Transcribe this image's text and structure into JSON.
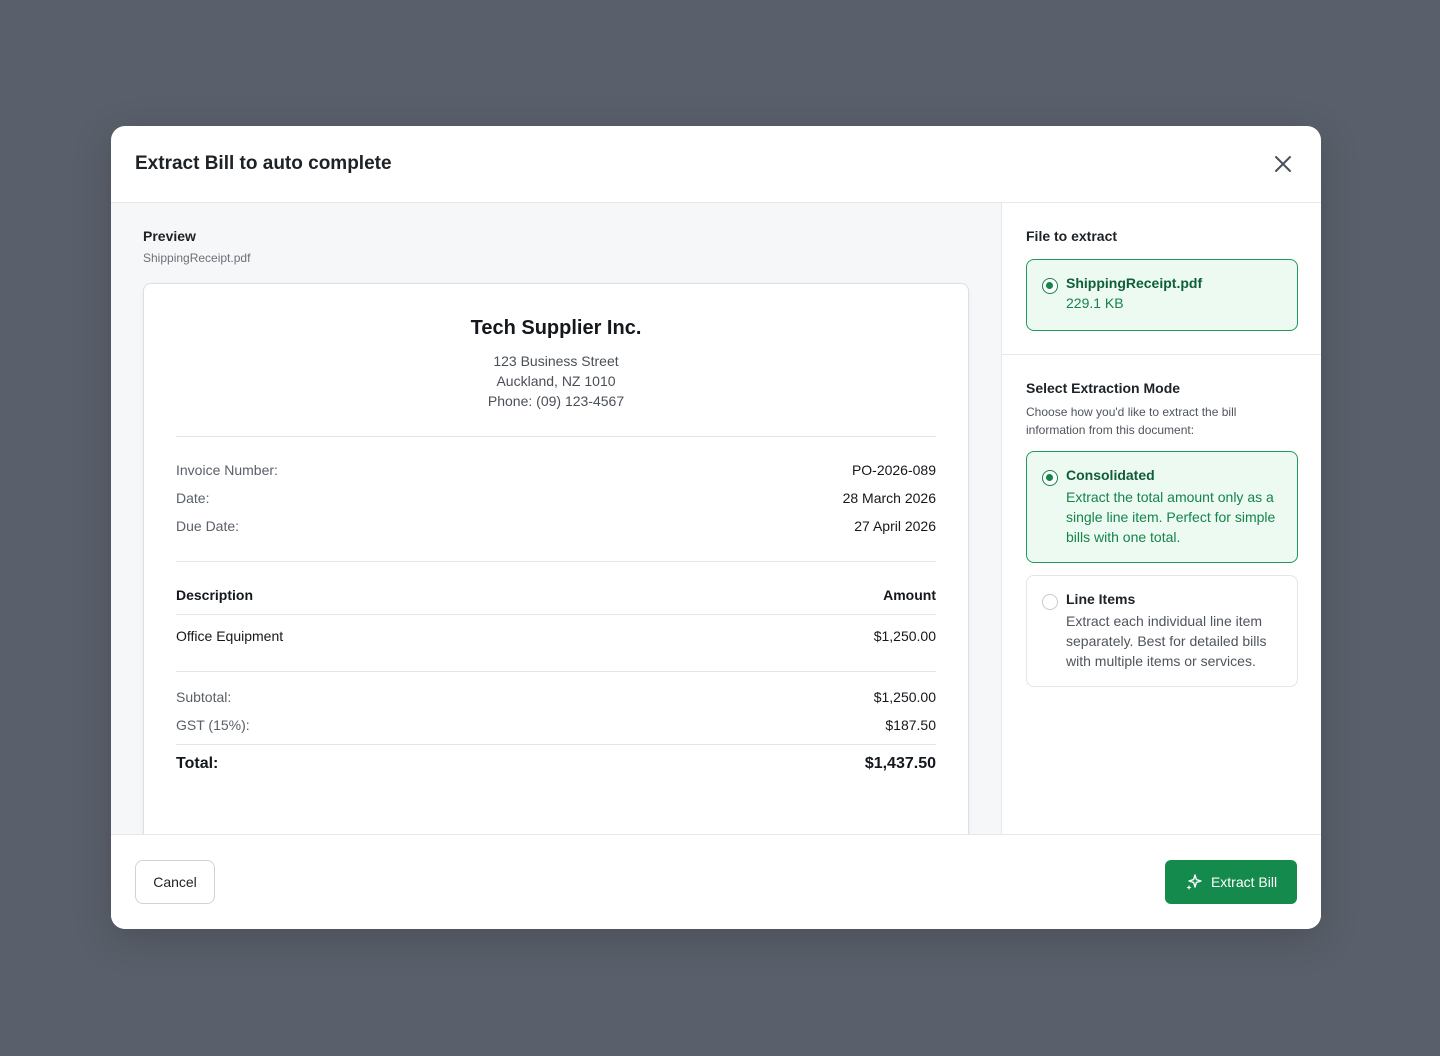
{
  "modal": {
    "title": "Extract Bill to auto complete"
  },
  "preview": {
    "label": "Preview",
    "filename": "ShippingReceipt.pdf"
  },
  "document": {
    "company": "Tech Supplier Inc.",
    "address_line1": "123 Business Street",
    "address_line2": "Auckland, NZ 1010",
    "phone": "Phone: (09) 123-4567",
    "meta": [
      {
        "label": "Invoice Number:",
        "value": "PO-2026-089"
      },
      {
        "label": "Date:",
        "value": "28 March 2026"
      },
      {
        "label": "Due Date:",
        "value": "27 April 2026"
      }
    ],
    "table_headers": {
      "description": "Description",
      "amount": "Amount"
    },
    "items": [
      {
        "description": "Office Equipment",
        "amount": "$1,250.00"
      }
    ],
    "subtotal_label": "Subtotal:",
    "subtotal_value": "$1,250.00",
    "gst_label": "GST (15%):",
    "gst_value": "$187.50",
    "total_label": "Total:",
    "total_value": "$1,437.50"
  },
  "file_section": {
    "title": "File to extract",
    "file_name": "ShippingReceipt.pdf",
    "file_size": "229.1 KB"
  },
  "mode_section": {
    "title": "Select Extraction Mode",
    "description": "Choose how you'd like to extract the bill information from this document:",
    "options": [
      {
        "title": "Consolidated",
        "description": "Extract the total amount only as a single line item. Perfect for simple bills with one total.",
        "selected": true
      },
      {
        "title": "Line Items",
        "description": "Extract each individual line item separately. Best for detailed bills with multiple items or services.",
        "selected": false
      }
    ]
  },
  "footer": {
    "cancel_label": "Cancel",
    "extract_label": "Extract Bill"
  },
  "colors": {
    "accent": "#158a4d",
    "selected_bg": "#ecfaf2",
    "overlay": "#5a606b"
  }
}
